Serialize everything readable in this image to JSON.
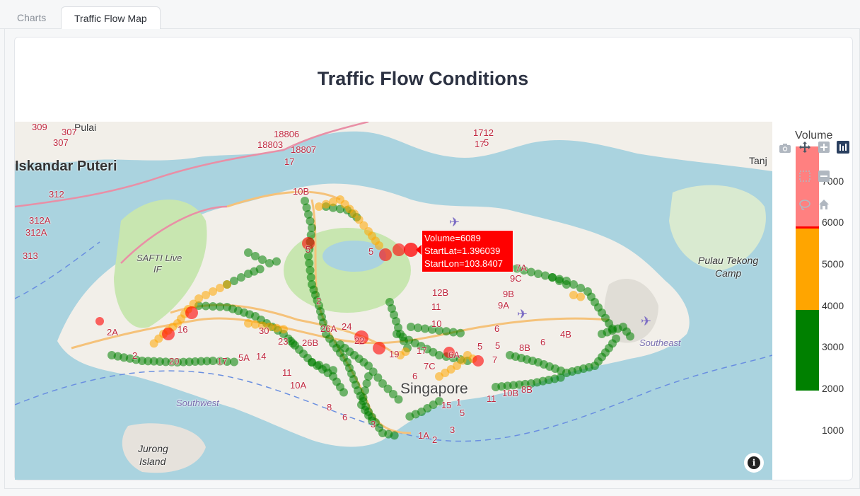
{
  "tabs": [
    {
      "label": "Charts",
      "active": false
    },
    {
      "label": "Traffic Flow Map",
      "active": true
    }
  ],
  "title": "Traffic Flow Conditions",
  "colorbar": {
    "title": "Volume",
    "ticks": [
      "7000",
      "6000",
      "5000",
      "4000",
      "3000",
      "2000",
      "1000"
    ],
    "bands": [
      {
        "color": "#ff8080",
        "from": 6000,
        "to": 7800
      },
      {
        "color": "#ffa500",
        "from": 4000,
        "to": 5900
      },
      {
        "color": "#008000",
        "from": 2000,
        "to": 4000
      }
    ],
    "threshold_line": "#ff0000"
  },
  "hover": {
    "line1": "Volume=6089",
    "line2": "StartLat=1.396039",
    "line3": "StartLon=103.8407"
  },
  "map_labels": {
    "iskandar": "Iskandar Puteri",
    "singapore": "Singapore",
    "southwest": "Southwest",
    "southeast": "Southeast",
    "jurong1": "Jurong",
    "jurong2": "Island",
    "tekong1": "Pulau Tekong",
    "tekong2": "Camp",
    "safti1": "SAFTI Live",
    "safti2": "IF",
    "pulai": "Pulai",
    "tanj": "Tanj",
    "r309": "309",
    "r307a": "307",
    "r307b": "307",
    "r312": "312",
    "r312a": "312A",
    "r312a2": "312A",
    "r313": "313",
    "r18806": "18806",
    "r18803": "18803",
    "r18807": "18807",
    "r17a": "17",
    "r1712": "1712",
    "r17b": "17",
    "r5a": "5",
    "r10b": "10B",
    "r5b": "5",
    "r5c": "5",
    "r2": "2",
    "r26a": "26A",
    "r24": "24",
    "r22": "22",
    "r26b": "26B",
    "r23": "23",
    "r30": "30",
    "r16": "16",
    "r20": "20",
    "r17c": "17",
    "r5a2": "5A",
    "r14": "14",
    "r11": "11",
    "r10a": "10A",
    "r8": "8",
    "r6a": "6",
    "r3": "3",
    "r1a": "1A",
    "r2b": "2",
    "r3b": "3",
    "r15": "15",
    "r5d": "5",
    "r1": "1",
    "r11b": "11",
    "r10b2": "10B",
    "r8b": "8B",
    "r7c": "7C",
    "r10": "10",
    "r11c": "11",
    "r12b": "12B",
    "r9c": "9C",
    "r9b": "9B",
    "r9a": "9A",
    "r7a": "7A",
    "r6b": "6",
    "r4b": "4B",
    "r6c": "6",
    "r19": "19",
    "r17d": "17",
    "r5e": "5",
    "r6d": "6",
    "r8b2": "8B",
    "r2a": "2A",
    "r2c": "2",
    "r6a2": "6A",
    "r7b": "7",
    "r5f": "5"
  },
  "icons": {
    "info": "info-icon",
    "camera": "camera-icon",
    "pan": "pan-icon",
    "zoom_in": "zoom-in-icon",
    "select": "box-select-icon",
    "zoom_out": "zoom-out-icon",
    "lasso": "lasso-icon",
    "home": "home-icon",
    "plotly": "plotly-logo-icon",
    "airport": "airplane-icon"
  },
  "colors": {
    "water": "#aad3df",
    "land": "#f2efe9",
    "green": "#c8e6b0",
    "high": "#ff0000",
    "medium": "#ffa500",
    "low": "#008000"
  }
}
